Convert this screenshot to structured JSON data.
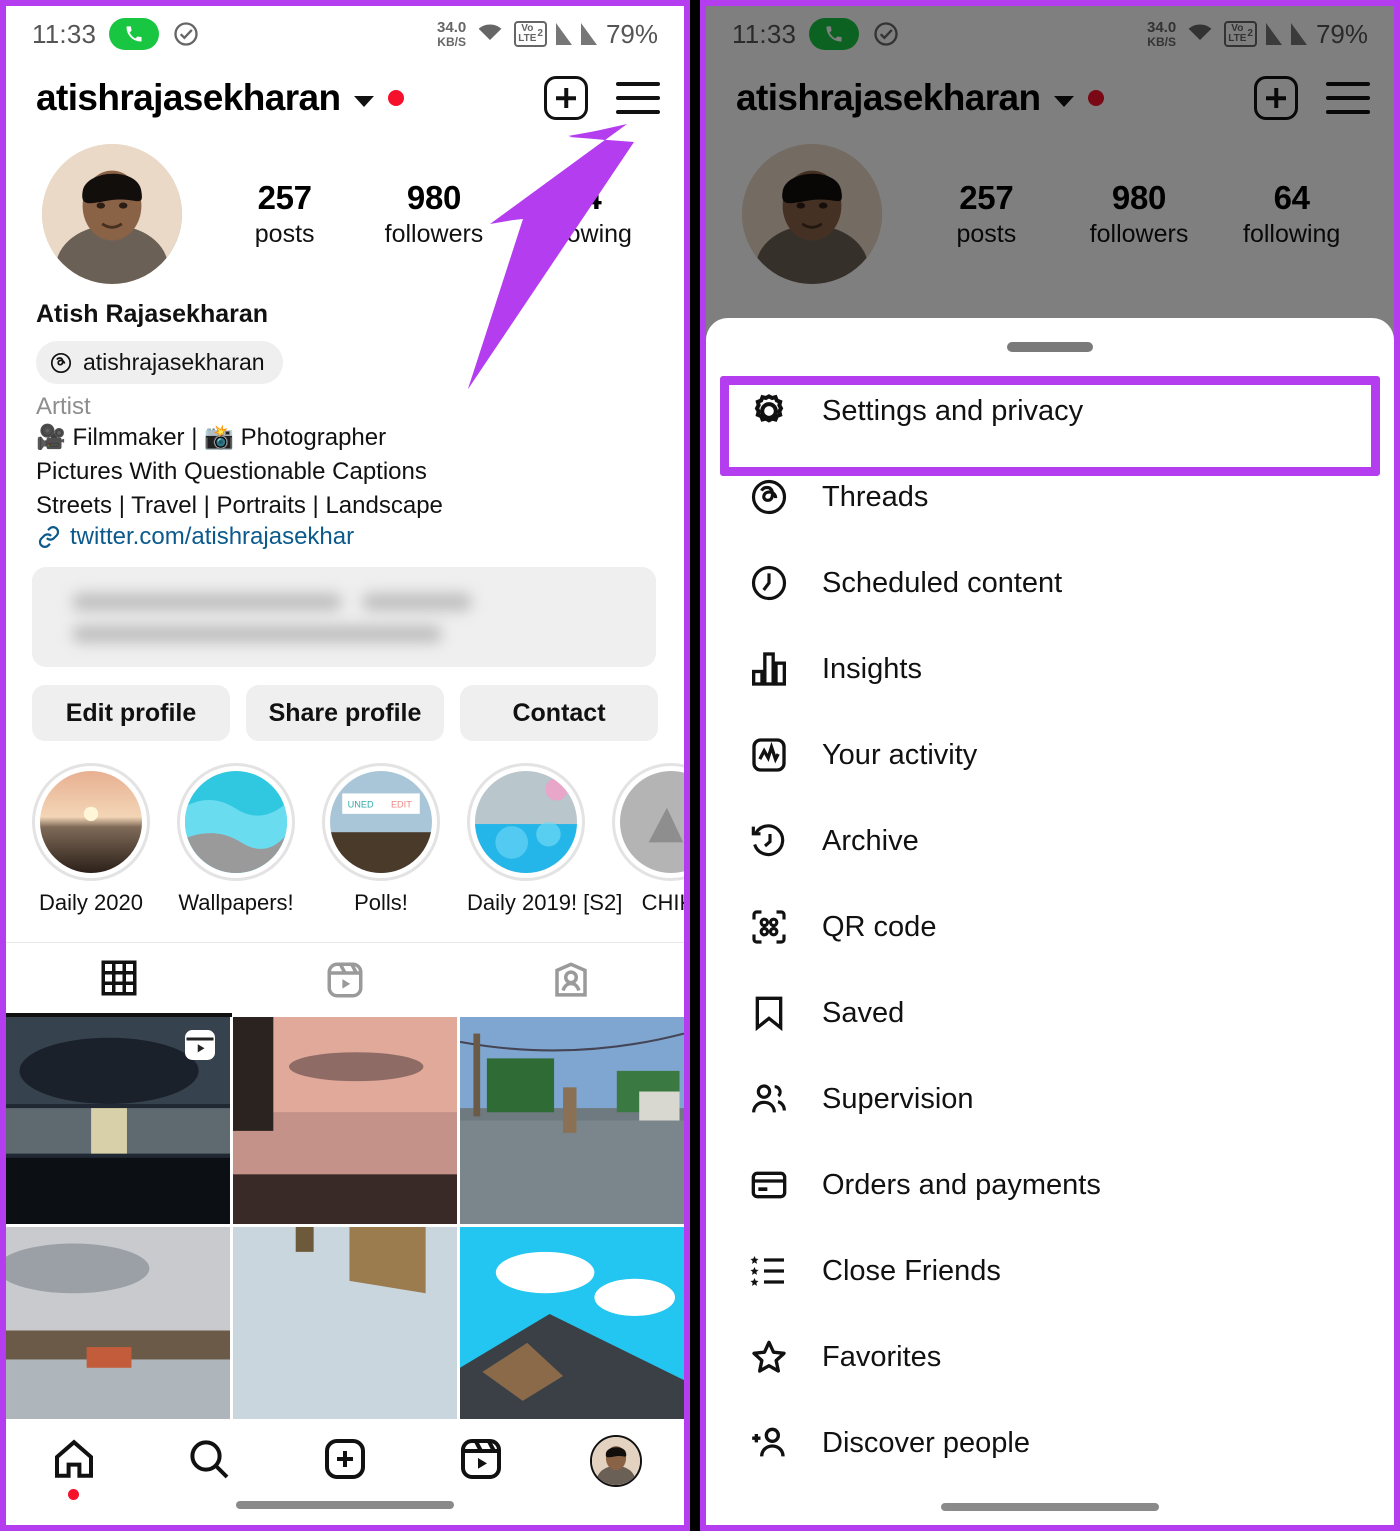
{
  "accent_purple": "#b43df0",
  "status_bar": {
    "time": "11:33",
    "data_rate": "34.0",
    "data_unit": "KB/S",
    "network": "VoLTE",
    "sim_number": "2",
    "battery": "79%",
    "icons": [
      "phone-call-icon",
      "check-circle-icon",
      "wifi-icon",
      "volte-icon",
      "signal-bars-icon"
    ]
  },
  "profile": {
    "username": "atishrajasekharan",
    "full_name": "Atish Rajasekharan",
    "threads_handle": "atishrajasekharan",
    "category": "Artist",
    "bio_lines": [
      "🎥 Filmmaker | 📸 Photographer",
      "Pictures With Questionable Captions",
      "Streets | Travel | Portraits | Landscape"
    ],
    "link": "twitter.com/atishrajasekhar",
    "stats": [
      {
        "value": "257",
        "label": "posts"
      },
      {
        "value": "980",
        "label": "followers"
      },
      {
        "value": "64",
        "label": "following"
      }
    ],
    "actions": [
      "Edit profile",
      "Share profile",
      "Contact"
    ],
    "highlights": [
      {
        "label": "Daily 2020"
      },
      {
        "label": "Wallpapers!"
      },
      {
        "label": "Polls!"
      },
      {
        "label": "Daily 2019! [S2]"
      },
      {
        "label": "CHIKI"
      }
    ],
    "tabs": [
      {
        "name": "grid-tab",
        "active": true
      },
      {
        "name": "reels-tab",
        "active": false
      },
      {
        "name": "tagged-tab",
        "active": false
      }
    ]
  },
  "bottom_nav": [
    {
      "name": "home-nav",
      "icon": "home-icon",
      "badge": true
    },
    {
      "name": "search-nav",
      "icon": "search-icon",
      "badge": false
    },
    {
      "name": "create-nav",
      "icon": "plus-box-icon",
      "badge": false
    },
    {
      "name": "reels-nav",
      "icon": "reels-icon",
      "badge": false
    },
    {
      "name": "profile-nav",
      "icon": "avatar-icon",
      "badge": false
    }
  ],
  "menu_sheet": {
    "highlighted_item": "Settings and privacy",
    "items": [
      {
        "label": "Settings and privacy",
        "icon": "gear-icon",
        "highlighted": true
      },
      {
        "label": "Threads",
        "icon": "threads-icon",
        "highlighted": false
      },
      {
        "label": "Scheduled content",
        "icon": "clock-icon",
        "highlighted": false
      },
      {
        "label": "Insights",
        "icon": "bar-chart-icon",
        "highlighted": false
      },
      {
        "label": "Your activity",
        "icon": "activity-icon",
        "highlighted": false
      },
      {
        "label": "Archive",
        "icon": "archive-clock-icon",
        "highlighted": false
      },
      {
        "label": "QR code",
        "icon": "qr-code-icon",
        "highlighted": false
      },
      {
        "label": "Saved",
        "icon": "bookmark-icon",
        "highlighted": false
      },
      {
        "label": "Supervision",
        "icon": "people-icon",
        "highlighted": false
      },
      {
        "label": "Orders and payments",
        "icon": "credit-card-icon",
        "highlighted": false
      },
      {
        "label": "Close Friends",
        "icon": "star-list-icon",
        "highlighted": false
      },
      {
        "label": "Favorites",
        "icon": "star-icon",
        "highlighted": false
      },
      {
        "label": "Discover people",
        "icon": "add-person-icon",
        "highlighted": false
      }
    ]
  },
  "annotation": {
    "arrow_target": "hamburger-menu-button",
    "arrow_color": "#b43df0"
  }
}
